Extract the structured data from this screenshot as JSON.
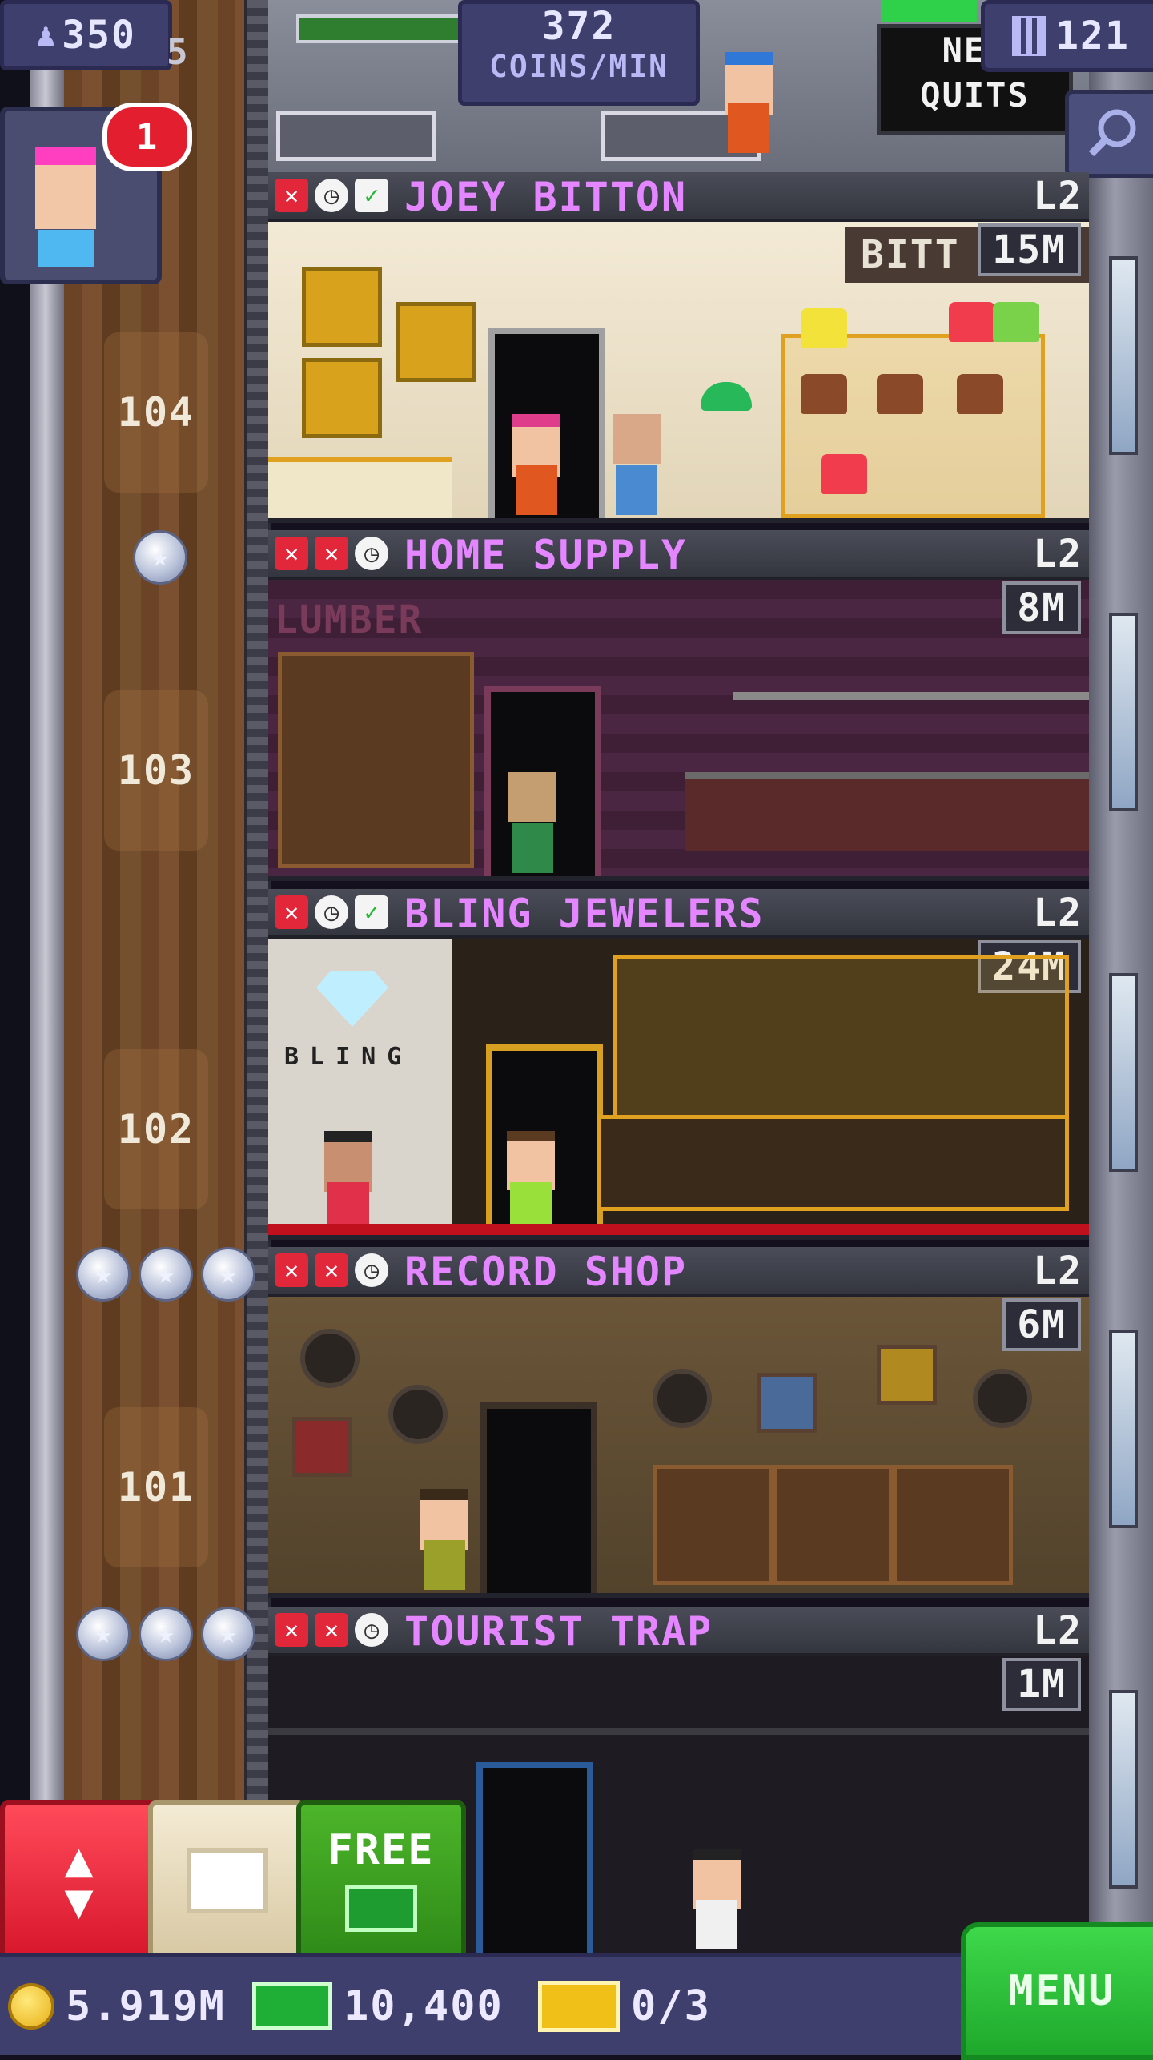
{
  "hud": {
    "population": "350",
    "shaft_top_number": "5",
    "coins_rate_value": "372",
    "coins_rate_label": "COINS/MIN",
    "new_quits_label": "NEW QUITS",
    "building_count": "121",
    "notification_count": "1"
  },
  "floors": [
    {
      "name": "JOEY BITTON",
      "level": "L2",
      "stock": "15M",
      "number": "104",
      "stars": 1,
      "sign_text": "BITT"
    },
    {
      "name": "HOME SUPPLY",
      "level": "L2",
      "stock": "8M",
      "number": "103",
      "stars": 0,
      "sign_text": "LUMBER"
    },
    {
      "name": "BLING JEWELERS",
      "level": "L2",
      "stock": "24M",
      "number": "102",
      "stars": 3,
      "sign_text": "BLING"
    },
    {
      "name": "RECORD SHOP",
      "level": "L2",
      "stock": "6M",
      "number": "101",
      "stars": 3
    },
    {
      "name": "TOURIST TRAP",
      "level": "L2",
      "stock": "1M"
    }
  ],
  "toolbar": {
    "free_label": "FREE"
  },
  "bottom_bar": {
    "coins": "5.919M",
    "bux": "10,400",
    "tickets": "0/3",
    "menu_label": "MENU"
  },
  "colors": {
    "floor_name": "#e486ff",
    "hud_panel": "#3f3f6e",
    "menu_green": "#2fc23a",
    "elevator_red": "#e8202f"
  }
}
